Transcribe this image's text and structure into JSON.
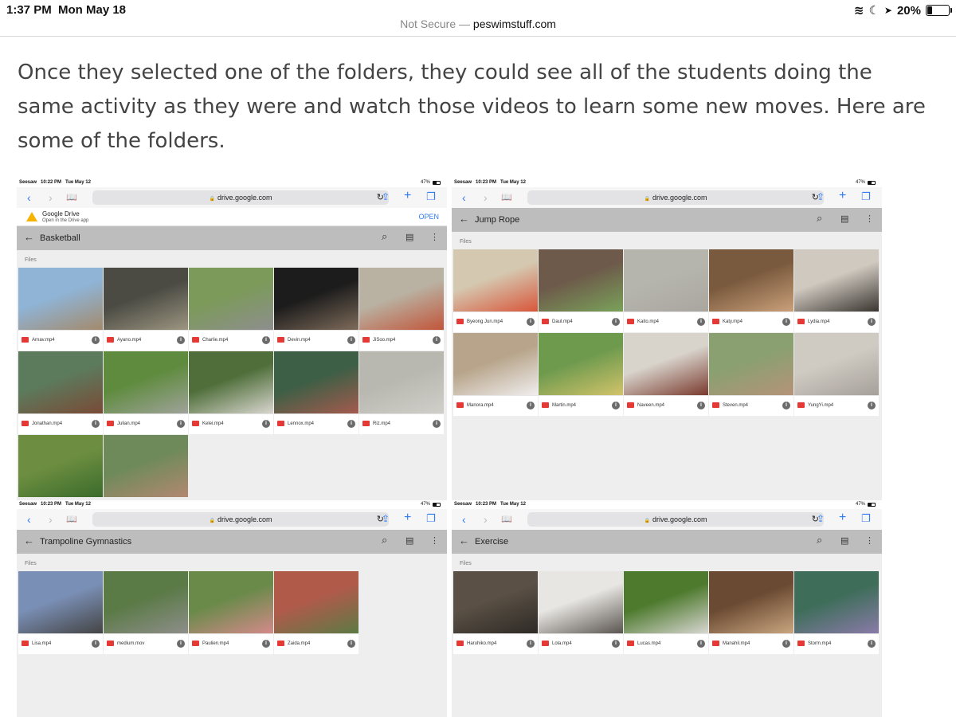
{
  "ipad": {
    "time": "1:37 PM",
    "date": "Mon May 18",
    "battery": "20%",
    "battery_level": 0.2,
    "url_not_secure": "Not Secure —",
    "url_domain": "peswimstuff.com"
  },
  "article": {
    "text": "Once they selected one of the folders, they could see all of the students doing the same activity as they were and watch those videos to learn some new moves. Here are some of the folders."
  },
  "icons": {
    "back": "‹",
    "forward": "›",
    "bookmarks": "📖",
    "lock": "🔒",
    "reload": "↻",
    "share": "⇪",
    "add": "+",
    "tabs": "❐",
    "arrow_back": "←",
    "search": "⌕",
    "list": "▤",
    "more": "⋮",
    "info": "i",
    "wifi": "≋",
    "moon": "☾",
    "location": "➤"
  },
  "shots": [
    {
      "app": "Seesaw",
      "time": "10:22 PM",
      "date": "Tue May 12",
      "battery": "47%",
      "url": "drive.google.com",
      "banner": {
        "title": "Google Drive",
        "subtitle": "Open in the Drive app",
        "action": "OPEN"
      },
      "folder": "Basketball",
      "files_label": "Files",
      "files": [
        {
          "name": "Arnav.mp4",
          "c1": "#8fb4d6",
          "c2": "#a38a6c"
        },
        {
          "name": "Ayano.mp4",
          "c1": "#4b4b44",
          "c2": "#9c9580"
        },
        {
          "name": "Charlie.mp4",
          "c1": "#7c9a5a",
          "c2": "#8e8e8e"
        },
        {
          "name": "Devin.mp4",
          "c1": "#1c1c1c",
          "c2": "#7e6b5a"
        },
        {
          "name": "JiSoo.mp4",
          "c1": "#b9b2a2",
          "c2": "#c2553a"
        },
        {
          "name": "Jonathan.mp4",
          "c1": "#5c7a5c",
          "c2": "#7a4a36"
        },
        {
          "name": "Julian.mp4",
          "c1": "#5f8b3e",
          "c2": "#9fa39a"
        },
        {
          "name": "Kelei.mp4",
          "c1": "#4f6e3a",
          "c2": "#d9d6cf"
        },
        {
          "name": "Lennox.mp4",
          "c1": "#3c5f45",
          "c2": "#a45a4e"
        },
        {
          "name": "Riz.mp4",
          "c1": "#b8b7b0",
          "c2": "#d0cfc9"
        },
        {
          "name": "",
          "c1": "#6d8e40",
          "c2": "#3a6b2c"
        },
        {
          "name": "",
          "c1": "#6f8a5a",
          "c2": "#b28872"
        }
      ]
    },
    {
      "app": "Seesaw",
      "time": "10:23 PM",
      "date": "Tue May 12",
      "battery": "47%",
      "url": "drive.google.com",
      "folder": "Jump Rope",
      "files_label": "Files",
      "files": [
        {
          "name": "Byeong Jun.mp4",
          "c1": "#d5c8b0",
          "c2": "#d8563a"
        },
        {
          "name": "Daul.mp4",
          "c1": "#6d5a4a",
          "c2": "#7aa25a"
        },
        {
          "name": "Kaito.mp4",
          "c1": "#b6b5ad",
          "c2": "#a9a6a0"
        },
        {
          "name": "Katy.mp4",
          "c1": "#7a5a3e",
          "c2": "#caa07a"
        },
        {
          "name": "Lydia.mp4",
          "c1": "#cfc9c0",
          "c2": "#3a3530"
        },
        {
          "name": "Manora.mp4",
          "c1": "#b7a48a",
          "c2": "#f0eeee"
        },
        {
          "name": "Martin.mp4",
          "c1": "#6e9a4e",
          "c2": "#d2c36a"
        },
        {
          "name": "Naveen.mp4",
          "c1": "#d8d4cc",
          "c2": "#7a3a2e"
        },
        {
          "name": "Steven.mp4",
          "c1": "#8aa070",
          "c2": "#b5937a"
        },
        {
          "name": "YungYi.mp4",
          "c1": "#cfcac2",
          "c2": "#a6a09a"
        }
      ]
    },
    {
      "app": "Seesaw",
      "time": "10:23 PM",
      "date": "Tue May 12",
      "battery": "47%",
      "url": "drive.google.com",
      "folder": "Trampoline Gymnastics",
      "files_label": "Files",
      "files": [
        {
          "name": "Lisa.mp4",
          "c1": "#7a8fb5",
          "c2": "#444444"
        },
        {
          "name": "medium.mov",
          "c1": "#5a7a46",
          "c2": "#8e8e8a"
        },
        {
          "name": "Paulien.mp4",
          "c1": "#6a8a4a",
          "c2": "#d48a8a"
        },
        {
          "name": "Zaida.mp4",
          "c1": "#b05a4a",
          "c2": "#5d7a45"
        }
      ]
    },
    {
      "app": "Seesaw",
      "time": "10:23 PM",
      "date": "Tue May 12",
      "battery": "47%",
      "url": "drive.google.com",
      "folder": "Exercise",
      "files_label": "Files",
      "files": [
        {
          "name": "Haruhiko.mp4",
          "c1": "#5a5045",
          "c2": "#2e2a26"
        },
        {
          "name": "Lola.mp4",
          "c1": "#e8e6e2",
          "c2": "#5a5550"
        },
        {
          "name": "Lucas.mp4",
          "c1": "#4e7a2e",
          "c2": "#d8d6d2"
        },
        {
          "name": "Manahil.mp4",
          "c1": "#6a4a32",
          "c2": "#caa680"
        },
        {
          "name": "Storm.mp4",
          "c1": "#3e6e5a",
          "c2": "#8a7aa8"
        }
      ]
    }
  ]
}
